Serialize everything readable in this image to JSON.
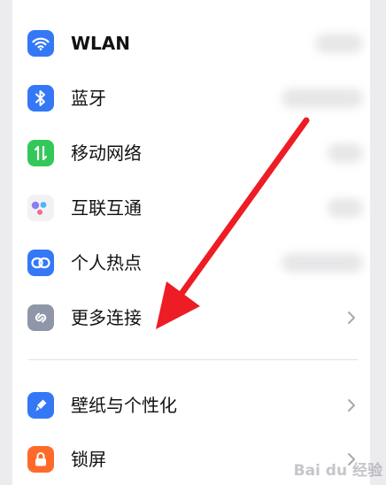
{
  "settings": {
    "items": [
      {
        "label": "WLAN",
        "icon": "wifi-icon",
        "color": "#3478f6"
      },
      {
        "label": "蓝牙",
        "icon": "bluetooth-icon",
        "color": "#3478f6"
      },
      {
        "label": "移动网络",
        "icon": "mobile-network-icon",
        "color": "#34c759"
      },
      {
        "label": "互联互通",
        "icon": "interconnect-icon",
        "color": "#f2f2f4"
      },
      {
        "label": "个人热点",
        "icon": "hotspot-link-icon",
        "color": "#3478f6"
      },
      {
        "label": "更多连接",
        "icon": "more-connections-icon",
        "color": "#8e96a8"
      },
      {
        "label": "壁纸与个性化",
        "icon": "wallpaper-brush-icon",
        "color": "#3478f6"
      },
      {
        "label": "锁屏",
        "icon": "lock-icon",
        "color": "#ff6a2a"
      }
    ]
  },
  "annotation": {
    "arrow_color": "#ee1c24"
  },
  "watermark": {
    "text": "Bai du 经验"
  }
}
